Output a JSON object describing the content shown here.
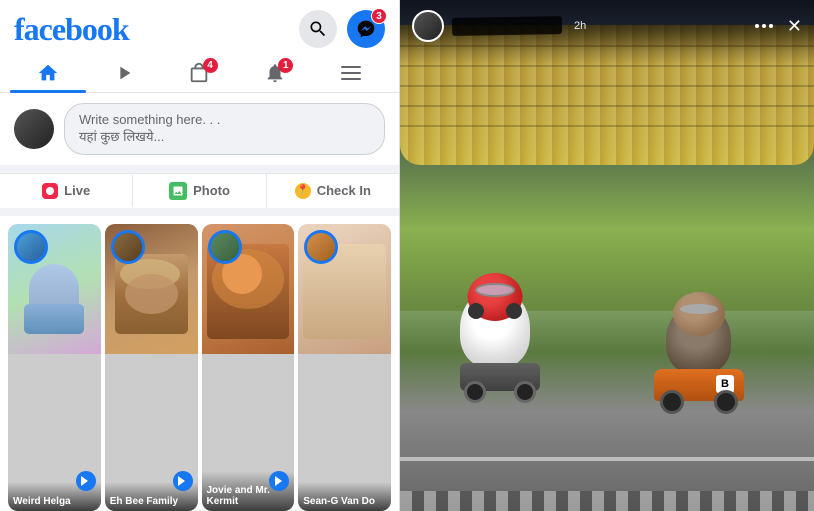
{
  "app": {
    "name": "facebook",
    "logo": "facebook"
  },
  "header": {
    "title": "facebook",
    "search_label": "Search",
    "messenger_label": "Messenger",
    "messenger_badge": "3"
  },
  "nav": {
    "tabs": [
      {
        "label": "Home",
        "icon": "home",
        "active": true
      },
      {
        "label": "Watch",
        "icon": "play"
      },
      {
        "label": "Marketplace",
        "icon": "shop",
        "badge": "4"
      },
      {
        "label": "Notifications",
        "icon": "bell",
        "badge": "1"
      },
      {
        "label": "Menu",
        "icon": "menu"
      }
    ]
  },
  "post_box": {
    "placeholder_line1": "Write something here. . .",
    "placeholder_line2": "यहां कुछ लिखये..."
  },
  "action_bar": {
    "live_label": "Live",
    "photo_label": "Photo",
    "checkin_label": "Check In"
  },
  "stories": [
    {
      "id": 1,
      "name": "Weird Helga",
      "has_arrow": true
    },
    {
      "id": 2,
      "name": "Eh Bee Family",
      "has_arrow": true
    },
    {
      "id": 3,
      "name": "Jovie and Mr. Kermit",
      "has_arrow": true
    },
    {
      "id": 4,
      "name": "Sean-G Van Do",
      "has_arrow": false
    }
  ],
  "story_view": {
    "user_name": "██████████",
    "time": "2h",
    "close_label": "Close"
  }
}
